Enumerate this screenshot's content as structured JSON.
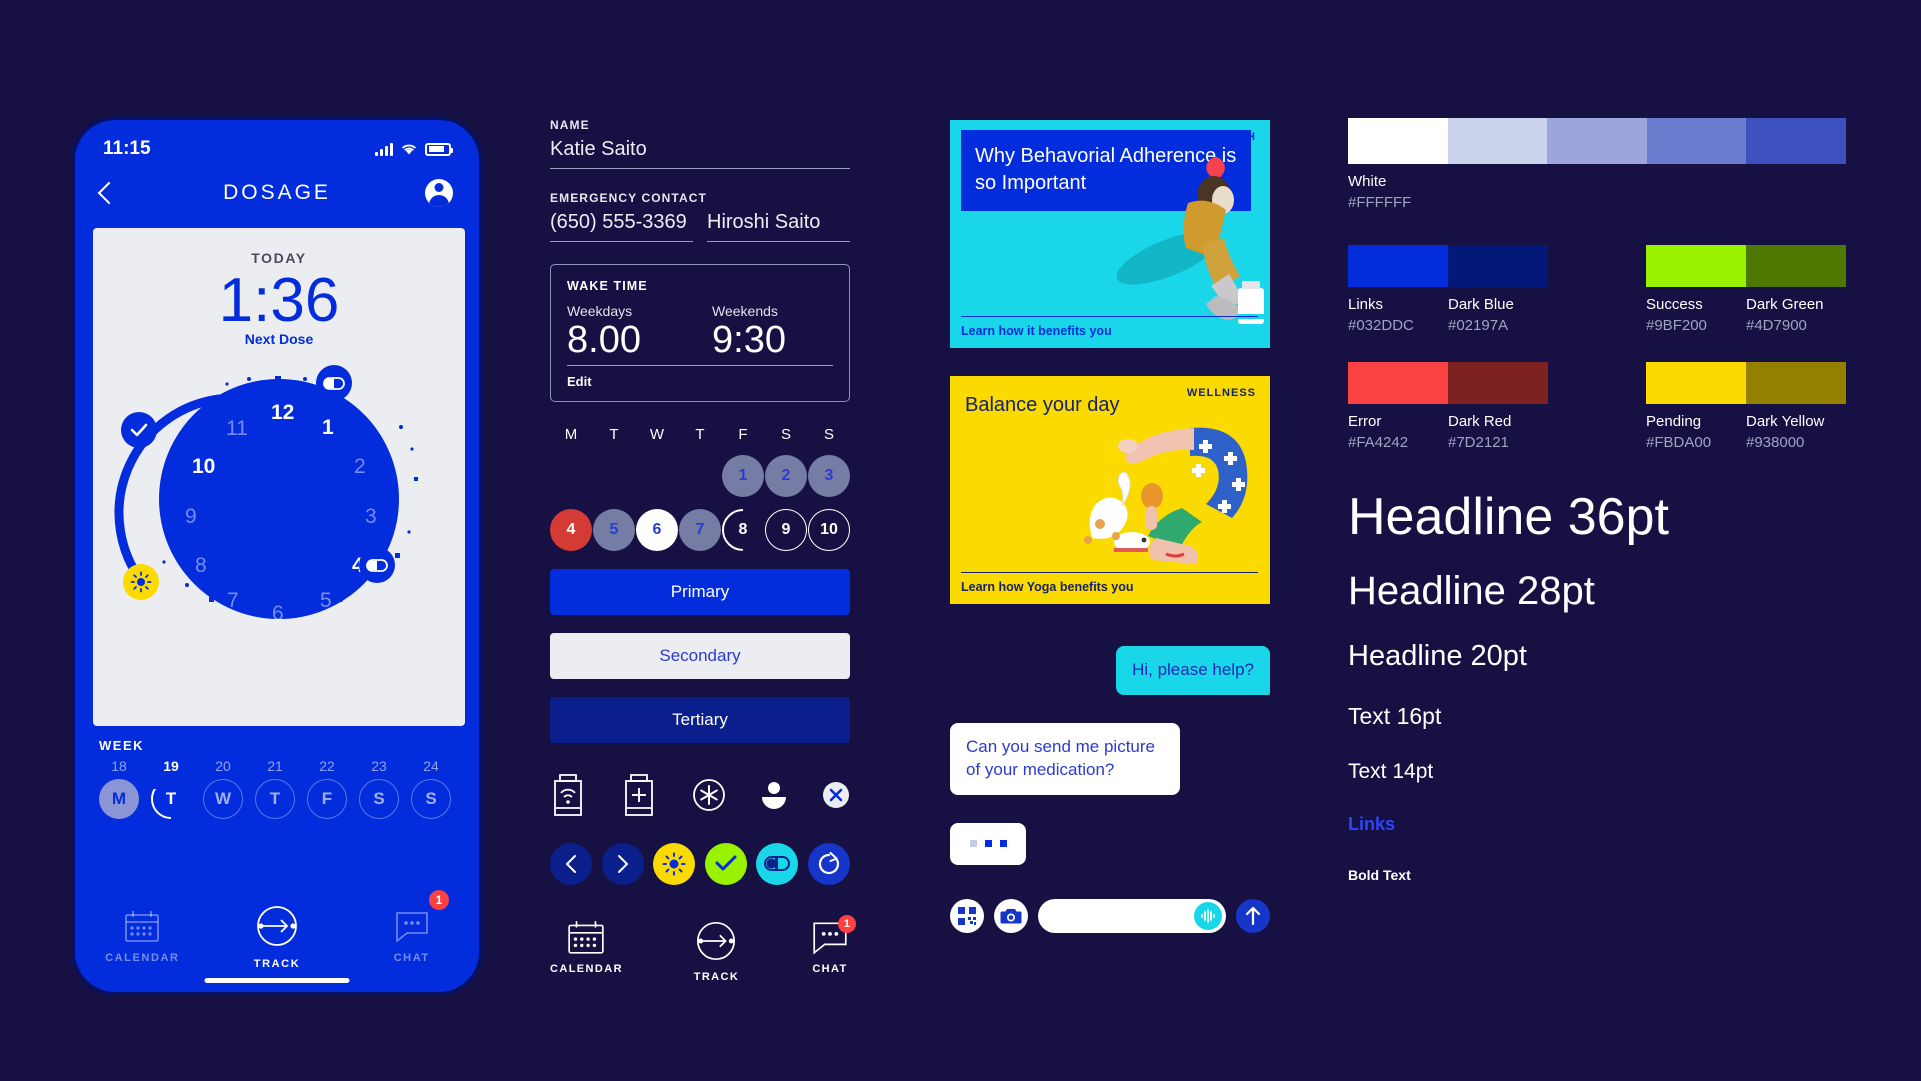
{
  "phone": {
    "status": {
      "time": "11:15"
    },
    "nav": {
      "title": "DOSAGE"
    },
    "today_label": "TODAY",
    "next_dose_time": "1:36",
    "next_dose_caption": "Next Dose",
    "clock_numbers": [
      "12",
      "1",
      "2",
      "3",
      "4",
      "5",
      "6",
      "7",
      "8",
      "9",
      "10",
      "11"
    ],
    "week_label": "WEEK",
    "week_dates": [
      "18",
      "19",
      "20",
      "21",
      "22",
      "23",
      "24"
    ],
    "week_days": [
      "M",
      "T",
      "W",
      "T",
      "F",
      "S",
      "S"
    ],
    "tabs": [
      {
        "label": "CALENDAR",
        "icon": "calendar-icon",
        "badge": ""
      },
      {
        "label": "TRACK",
        "icon": "track-arrow-icon",
        "badge": ""
      },
      {
        "label": "CHAT",
        "icon": "chat-icon",
        "badge": "1"
      }
    ]
  },
  "form": {
    "name_label": "NAME",
    "name_value": "Katie Saito",
    "emergency_label": "EMERGENCY CONTACT",
    "emergency_phone": "(650) 555-3369",
    "emergency_name": "Hiroshi Saito",
    "wake": {
      "title": "WAKE TIME",
      "weekdays_label": "Weekdays",
      "weekdays_value": "8.00",
      "weekends_label": "Weekends",
      "weekends_value": "9:30",
      "edit_label": "Edit"
    },
    "dow": [
      "M",
      "T",
      "W",
      "T",
      "F",
      "S",
      "S"
    ],
    "pills_row1": [
      "",
      "",
      "",
      "",
      "1",
      "2",
      "3"
    ],
    "pills_row2": [
      "4",
      "5",
      "6",
      "7",
      "8",
      "9",
      "10"
    ],
    "buttons": {
      "primary": "Primary",
      "secondary": "Secondary",
      "tertiary": "Tertiary"
    },
    "icons_row1": [
      "bottle-wifi-icon",
      "bottle-plus-icon",
      "asterisk-circle-icon",
      "avatar-icon",
      "close-circle-icon"
    ],
    "icons_row2": [
      "chevron-left-icon",
      "chevron-right-icon",
      "sun-icon",
      "check-icon",
      "pill-icon",
      "refresh-icon"
    ],
    "nav_items": [
      {
        "label": "CALENDAR",
        "icon": "calendar-icon",
        "badge": ""
      },
      {
        "label": "TRACK",
        "icon": "track-arrow-icon",
        "badge": ""
      },
      {
        "label": "CHAT",
        "icon": "chat-icon",
        "badge": "1"
      }
    ]
  },
  "cards": [
    {
      "kicker": "HEALTH",
      "title": "Why Behavorial Adherence is so Important",
      "cta": "Learn how it benefits you"
    },
    {
      "kicker": "WELLNESS",
      "title": "Balance your day",
      "cta": "Learn how Yoga benefits you"
    }
  ],
  "chat": {
    "outgoing": "Hi, please help?",
    "incoming": "Can you send me picture of your medication?",
    "input_placeholder": "",
    "icons": [
      "qr-icon",
      "camera-icon",
      "mic-icon",
      "send-up-icon"
    ]
  },
  "palette": {
    "tint_strip": [
      "#FFFFFF",
      "#CBD3EC",
      "#9BA7DC",
      "#6B7BCE",
      "#3D51BE"
    ],
    "tint_name": "White",
    "tint_hex": "#FFFFFF",
    "sets": [
      {
        "swatches": [
          "#032DDC",
          "#02197A"
        ],
        "names": [
          "Links",
          "Dark Blue"
        ],
        "hexes": [
          "#032DDC",
          "#02197A"
        ]
      },
      {
        "swatches": [
          "#9BF200",
          "#4D7900"
        ],
        "names": [
          "Success",
          "Dark Green"
        ],
        "hexes": [
          "#9BF200",
          "#4D7900"
        ]
      },
      {
        "swatches": [
          "#FA4242",
          "#7D2121"
        ],
        "names": [
          "Error",
          "Dark Red"
        ],
        "hexes": [
          "#FA4242",
          "#7D2121"
        ]
      },
      {
        "swatches": [
          "#FBDA00",
          "#938000"
        ],
        "names": [
          "Pending",
          "Dark Yellow"
        ],
        "hexes": [
          "#FBDA00",
          "#938000"
        ]
      }
    ]
  },
  "typography": {
    "h36": "Headline 36pt",
    "h28": "Headline 28pt",
    "h20": "Headline 20pt",
    "t16": "Text 16pt",
    "t14": "Text 14pt",
    "link": "Links",
    "bold": "Bold Text"
  }
}
